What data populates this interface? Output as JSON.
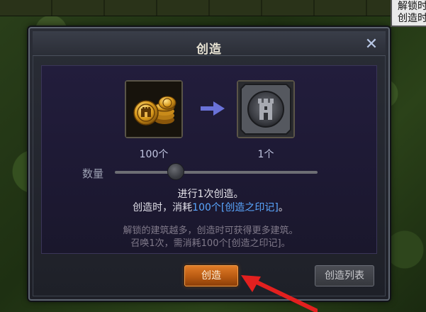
{
  "corner_note": {
    "line1": "解锁时",
    "line2": "创造时"
  },
  "dialog": {
    "title": "创造",
    "close_glyph": "✕",
    "cost": {
      "icon": "gold-coins-icon",
      "quantity": "100个"
    },
    "arrow_icon": "right-arrow-icon",
    "result": {
      "icon": "castle-tower-icon",
      "quantity": "1个"
    },
    "slider": {
      "label": "数量",
      "level": 0.3
    },
    "summary": {
      "line1": "进行1次创造。",
      "line2_prefix": "创造时，消耗",
      "line2_highlight": "100个[创造之印记]",
      "line2_suffix": "。"
    },
    "hints": {
      "line1": "解锁的建筑越多，创造时可获得更多建筑。",
      "line2": "召唤1次，需消耗100个[创造之印记]。"
    },
    "buttons": {
      "create": "创造",
      "list": "创造列表"
    }
  },
  "colors": {
    "accent_orange": "#d0701f",
    "highlight_blue": "#5aa7ff",
    "pointer_red": "#e3201f"
  }
}
